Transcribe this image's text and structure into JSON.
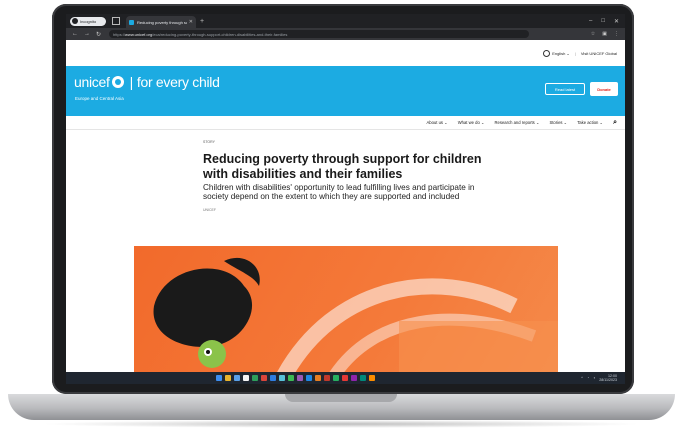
{
  "browser": {
    "profile_label": "Incognito",
    "tab_title": "Reducing poverty through supp",
    "address_host": "www.unicef.org",
    "address_path": "/eca/reducing-poverty-through-support-children-disabilities-and-their-families",
    "address_prefix": "https://"
  },
  "utility": {
    "language": "English",
    "visit_label": "Visit UNICEF Global"
  },
  "header": {
    "brand": "unicef",
    "tagline": "for every child",
    "region": "Europe and Central Asia",
    "read_button": "Read latest",
    "donate_button": "Donate"
  },
  "nav": {
    "items": [
      "About us",
      "What we do",
      "Research and reports",
      "Stories",
      "Take action"
    ]
  },
  "article": {
    "breadcrumb": "STORY",
    "title": "Reducing poverty through support for children with disabilities and their families",
    "subtitle": "Children with disabilities' opportunity to lead fulfilling lives and participate in society depend on the extent to which they are supported and included",
    "credit": "UNICEF"
  },
  "taskbar": {
    "time": "12:00",
    "date": "28/11/2023"
  },
  "colors": {
    "unicef_blue": "#1cabe2",
    "hero_orange": "#f26a2b",
    "donate_red": "#e2231a"
  }
}
